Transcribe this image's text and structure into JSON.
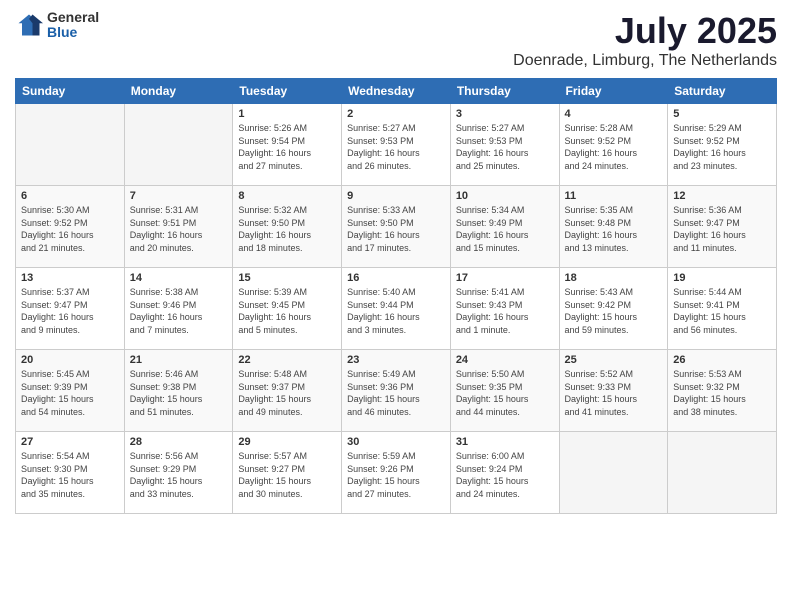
{
  "logo": {
    "general": "General",
    "blue": "Blue"
  },
  "title": {
    "month": "July 2025",
    "location": "Doenrade, Limburg, The Netherlands"
  },
  "weekdays": [
    "Sunday",
    "Monday",
    "Tuesday",
    "Wednesday",
    "Thursday",
    "Friday",
    "Saturday"
  ],
  "weeks": [
    [
      {
        "day": "",
        "info": ""
      },
      {
        "day": "",
        "info": ""
      },
      {
        "day": "1",
        "info": "Sunrise: 5:26 AM\nSunset: 9:54 PM\nDaylight: 16 hours\nand 27 minutes."
      },
      {
        "day": "2",
        "info": "Sunrise: 5:27 AM\nSunset: 9:53 PM\nDaylight: 16 hours\nand 26 minutes."
      },
      {
        "day": "3",
        "info": "Sunrise: 5:27 AM\nSunset: 9:53 PM\nDaylight: 16 hours\nand 25 minutes."
      },
      {
        "day": "4",
        "info": "Sunrise: 5:28 AM\nSunset: 9:52 PM\nDaylight: 16 hours\nand 24 minutes."
      },
      {
        "day": "5",
        "info": "Sunrise: 5:29 AM\nSunset: 9:52 PM\nDaylight: 16 hours\nand 23 minutes."
      }
    ],
    [
      {
        "day": "6",
        "info": "Sunrise: 5:30 AM\nSunset: 9:52 PM\nDaylight: 16 hours\nand 21 minutes."
      },
      {
        "day": "7",
        "info": "Sunrise: 5:31 AM\nSunset: 9:51 PM\nDaylight: 16 hours\nand 20 minutes."
      },
      {
        "day": "8",
        "info": "Sunrise: 5:32 AM\nSunset: 9:50 PM\nDaylight: 16 hours\nand 18 minutes."
      },
      {
        "day": "9",
        "info": "Sunrise: 5:33 AM\nSunset: 9:50 PM\nDaylight: 16 hours\nand 17 minutes."
      },
      {
        "day": "10",
        "info": "Sunrise: 5:34 AM\nSunset: 9:49 PM\nDaylight: 16 hours\nand 15 minutes."
      },
      {
        "day": "11",
        "info": "Sunrise: 5:35 AM\nSunset: 9:48 PM\nDaylight: 16 hours\nand 13 minutes."
      },
      {
        "day": "12",
        "info": "Sunrise: 5:36 AM\nSunset: 9:47 PM\nDaylight: 16 hours\nand 11 minutes."
      }
    ],
    [
      {
        "day": "13",
        "info": "Sunrise: 5:37 AM\nSunset: 9:47 PM\nDaylight: 16 hours\nand 9 minutes."
      },
      {
        "day": "14",
        "info": "Sunrise: 5:38 AM\nSunset: 9:46 PM\nDaylight: 16 hours\nand 7 minutes."
      },
      {
        "day": "15",
        "info": "Sunrise: 5:39 AM\nSunset: 9:45 PM\nDaylight: 16 hours\nand 5 minutes."
      },
      {
        "day": "16",
        "info": "Sunrise: 5:40 AM\nSunset: 9:44 PM\nDaylight: 16 hours\nand 3 minutes."
      },
      {
        "day": "17",
        "info": "Sunrise: 5:41 AM\nSunset: 9:43 PM\nDaylight: 16 hours\nand 1 minute."
      },
      {
        "day": "18",
        "info": "Sunrise: 5:43 AM\nSunset: 9:42 PM\nDaylight: 15 hours\nand 59 minutes."
      },
      {
        "day": "19",
        "info": "Sunrise: 5:44 AM\nSunset: 9:41 PM\nDaylight: 15 hours\nand 56 minutes."
      }
    ],
    [
      {
        "day": "20",
        "info": "Sunrise: 5:45 AM\nSunset: 9:39 PM\nDaylight: 15 hours\nand 54 minutes."
      },
      {
        "day": "21",
        "info": "Sunrise: 5:46 AM\nSunset: 9:38 PM\nDaylight: 15 hours\nand 51 minutes."
      },
      {
        "day": "22",
        "info": "Sunrise: 5:48 AM\nSunset: 9:37 PM\nDaylight: 15 hours\nand 49 minutes."
      },
      {
        "day": "23",
        "info": "Sunrise: 5:49 AM\nSunset: 9:36 PM\nDaylight: 15 hours\nand 46 minutes."
      },
      {
        "day": "24",
        "info": "Sunrise: 5:50 AM\nSunset: 9:35 PM\nDaylight: 15 hours\nand 44 minutes."
      },
      {
        "day": "25",
        "info": "Sunrise: 5:52 AM\nSunset: 9:33 PM\nDaylight: 15 hours\nand 41 minutes."
      },
      {
        "day": "26",
        "info": "Sunrise: 5:53 AM\nSunset: 9:32 PM\nDaylight: 15 hours\nand 38 minutes."
      }
    ],
    [
      {
        "day": "27",
        "info": "Sunrise: 5:54 AM\nSunset: 9:30 PM\nDaylight: 15 hours\nand 35 minutes."
      },
      {
        "day": "28",
        "info": "Sunrise: 5:56 AM\nSunset: 9:29 PM\nDaylight: 15 hours\nand 33 minutes."
      },
      {
        "day": "29",
        "info": "Sunrise: 5:57 AM\nSunset: 9:27 PM\nDaylight: 15 hours\nand 30 minutes."
      },
      {
        "day": "30",
        "info": "Sunrise: 5:59 AM\nSunset: 9:26 PM\nDaylight: 15 hours\nand 27 minutes."
      },
      {
        "day": "31",
        "info": "Sunrise: 6:00 AM\nSunset: 9:24 PM\nDaylight: 15 hours\nand 24 minutes."
      },
      {
        "day": "",
        "info": ""
      },
      {
        "day": "",
        "info": ""
      }
    ]
  ]
}
